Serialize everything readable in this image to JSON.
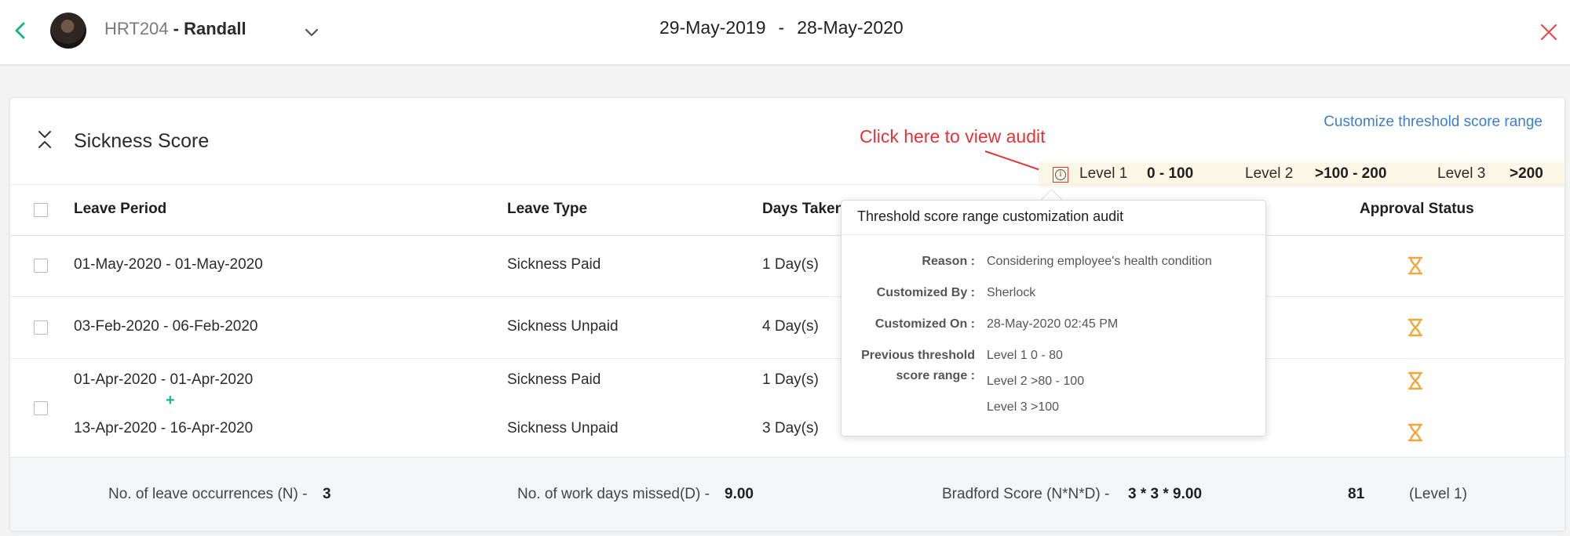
{
  "header": {
    "employee_code": "HRT204",
    "employee_separator": " - ",
    "employee_name": "Randall",
    "period_start": "29-May-2019",
    "period_dash": "-",
    "period_end": "28-May-2020"
  },
  "card": {
    "title": "Sickness Score",
    "customize_link": "Customize threshold score range",
    "annotation": "Click here to view audit"
  },
  "levels": [
    {
      "label": "Level 1",
      "range": "0 - 100"
    },
    {
      "label": "Level 2",
      "range": ">100 - 200"
    },
    {
      "label": "Level 3",
      "range": ">200"
    }
  ],
  "table": {
    "columns": [
      "Leave Period",
      "Leave Type",
      "Days Taken",
      "Approval Status"
    ],
    "rows": [
      {
        "period": "01-May-2020 - 01-May-2020",
        "type": "Sickness Paid",
        "days": "1 Day(s)"
      },
      {
        "period": "03-Feb-2020 - 06-Feb-2020",
        "type": "Sickness Unpaid",
        "days": "4 Day(s)"
      },
      {
        "period": "01-Apr-2020 - 01-Apr-2020",
        "type": "Sickness Paid",
        "days": "1 Day(s)"
      },
      {
        "period": "13-Apr-2020 - 16-Apr-2020",
        "type": "Sickness Unpaid",
        "days": "3 Day(s)"
      }
    ],
    "plus_symbol": "+"
  },
  "footer": {
    "occurrences_label": "No. of leave occurrences (N) -",
    "occurrences_value": "3",
    "missed_label": "No. of work days missed(D) -",
    "missed_value": "9.00",
    "bradford_label": "Bradford Score (N*N*D) -",
    "bradford_formula": "3 * 3 * 9.00",
    "bradford_value": "81",
    "bradford_level": "(Level 1)"
  },
  "audit_popover": {
    "title": "Threshold score range customization audit",
    "reason_label": "Reason :",
    "reason_value": "Considering employee's health condition",
    "by_label": "Customized By :",
    "by_value": "Sherlock",
    "on_label": "Customized On :",
    "on_value": "28-May-2020 02:45 PM",
    "prev_label_1": "Previous threshold",
    "prev_label_2": "score range :",
    "prev_values": [
      "Level 1 0 - 80",
      "Level 2 >80 - 100",
      "Level 3 >100"
    ]
  },
  "colors": {
    "accent_green": "#1bb48a",
    "link_blue": "#3d7ec9",
    "annotation_red": "#e23434",
    "pending_orange": "#f0a83c",
    "level_band": "#fbf7e6"
  }
}
